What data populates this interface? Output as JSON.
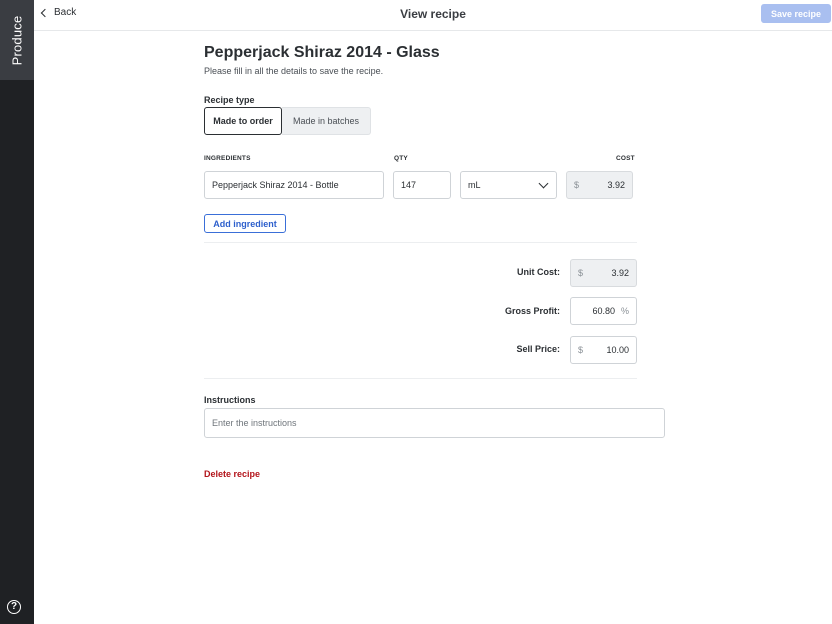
{
  "sidebar": {
    "section_label": "Produce",
    "help_glyph": "?"
  },
  "header": {
    "back_label": "Back",
    "title": "View recipe",
    "save_label": "Save recipe"
  },
  "recipe": {
    "title": "Pepperjack Shiraz 2014 - Glass",
    "subtitle": "Please fill in all the details to save the recipe.",
    "type_label": "Recipe type",
    "type_options": [
      "Made to order",
      "Made in batches"
    ],
    "type_selected": "Made to order"
  },
  "ingredients": {
    "headers": {
      "name": "INGREDIENTS",
      "qty": "QTY",
      "cost": "COST"
    },
    "rows": [
      {
        "name": "Pepperjack Shiraz 2014 - Bottle",
        "qty": "147",
        "unit": "mL",
        "currency": "$",
        "cost": "3.92"
      }
    ],
    "add_label": "Add ingredient"
  },
  "costing": {
    "unit_cost_label": "Unit Cost:",
    "unit_cost_currency": "$",
    "unit_cost": "3.92",
    "gross_profit_label": "Gross Profit:",
    "gross_profit": "60.80",
    "gross_profit_unit": "%",
    "sell_price_label": "Sell Price:",
    "sell_price_currency": "$",
    "sell_price": "10.00"
  },
  "instructions": {
    "label": "Instructions",
    "placeholder": "Enter the instructions"
  },
  "delete_label": "Delete recipe",
  "colors": {
    "primary": "#2d5fcc",
    "save_disabled": "#a9bff0",
    "danger": "#b3141b",
    "sidebar": "#1f2124"
  }
}
